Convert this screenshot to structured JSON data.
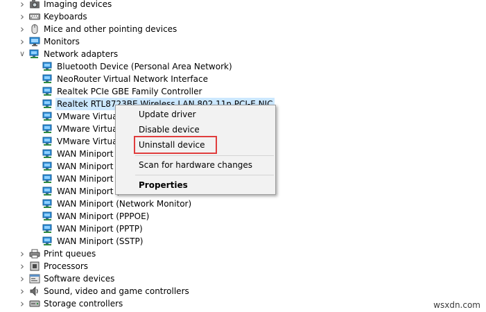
{
  "colors": {
    "selection": "#cce8ff",
    "highlight_box": "#e03c3c",
    "menu_background": "#f2f2f2"
  },
  "tree": [
    {
      "label": "Imaging devices",
      "level": 0,
      "expanded": false,
      "icon": "camera-icon"
    },
    {
      "label": "Keyboards",
      "level": 0,
      "expanded": false,
      "icon": "keyboard-icon"
    },
    {
      "label": "Mice and other pointing devices",
      "level": 0,
      "expanded": false,
      "icon": "mouse-icon"
    },
    {
      "label": "Monitors",
      "level": 0,
      "expanded": false,
      "icon": "monitor-icon"
    },
    {
      "label": "Network adapters",
      "level": 0,
      "expanded": true,
      "icon": "network-adapter-icon"
    },
    {
      "label": "Bluetooth Device (Personal Area Network)",
      "level": 1,
      "icon": "network-adapter-icon"
    },
    {
      "label": "NeoRouter Virtual Network Interface",
      "level": 1,
      "icon": "network-adapter-icon"
    },
    {
      "label": "Realtek PCIe GBE Family Controller",
      "level": 1,
      "icon": "network-adapter-icon"
    },
    {
      "label": "Realtek RTL8723BE Wireless LAN 802.11n PCI-E NIC",
      "level": 1,
      "icon": "network-adapter-icon",
      "selected": true
    },
    {
      "label": "VMware Virtual",
      "level": 1,
      "icon": "network-adapter-icon"
    },
    {
      "label": "VMware Virtual",
      "level": 1,
      "icon": "network-adapter-icon"
    },
    {
      "label": "VMware Virtual",
      "level": 1,
      "icon": "network-adapter-icon"
    },
    {
      "label": "WAN Miniport (",
      "level": 1,
      "icon": "network-adapter-icon"
    },
    {
      "label": "WAN Miniport (",
      "level": 1,
      "icon": "network-adapter-icon"
    },
    {
      "label": "WAN Miniport (",
      "level": 1,
      "icon": "network-adapter-icon"
    },
    {
      "label": "WAN Miniport (",
      "level": 1,
      "icon": "network-adapter-icon"
    },
    {
      "label": "WAN Miniport (Network Monitor)",
      "level": 1,
      "icon": "network-adapter-icon"
    },
    {
      "label": "WAN Miniport (PPPOE)",
      "level": 1,
      "icon": "network-adapter-icon"
    },
    {
      "label": "WAN Miniport (PPTP)",
      "level": 1,
      "icon": "network-adapter-icon"
    },
    {
      "label": "WAN Miniport (SSTP)",
      "level": 1,
      "icon": "network-adapter-icon"
    },
    {
      "label": "Print queues",
      "level": 0,
      "expanded": false,
      "icon": "printer-icon"
    },
    {
      "label": "Processors",
      "level": 0,
      "expanded": false,
      "icon": "processor-icon"
    },
    {
      "label": "Software devices",
      "level": 0,
      "expanded": false,
      "icon": "software-device-icon"
    },
    {
      "label": "Sound, video and game controllers",
      "level": 0,
      "expanded": false,
      "icon": "speaker-icon"
    },
    {
      "label": "Storage controllers",
      "level": 0,
      "expanded": false,
      "icon": "storage-icon"
    }
  ],
  "context_menu": {
    "update_driver": "Update driver",
    "disable_device": "Disable device",
    "uninstall_device": "Uninstall device",
    "scan_hardware": "Scan for hardware changes",
    "properties": "Properties"
  },
  "watermark": "wsxdn.com"
}
